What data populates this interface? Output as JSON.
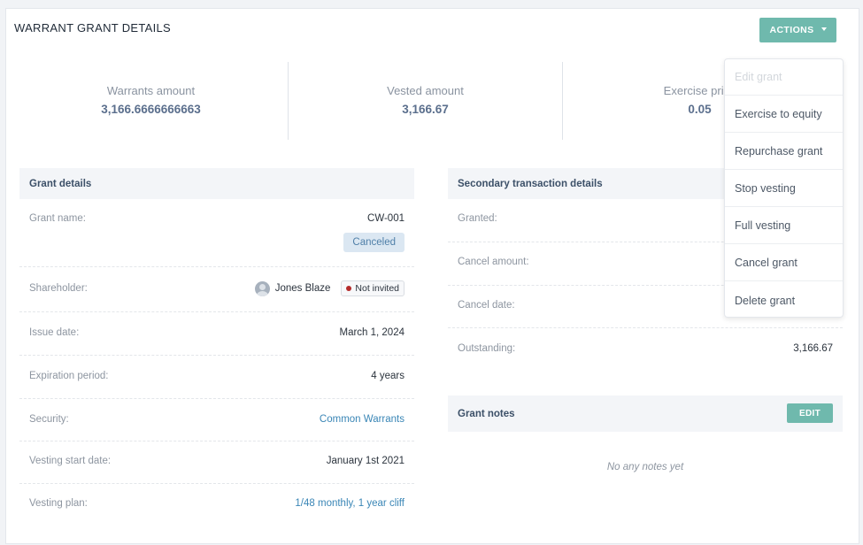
{
  "title": "WARRANT GRANT DETAILS",
  "actions_label": "ACTIONS",
  "stats": [
    {
      "label": "Warrants amount",
      "value": "3,166.6666666663"
    },
    {
      "label": "Vested amount",
      "value": "3,166.67"
    },
    {
      "label": "Exercise price",
      "value": "0.05"
    }
  ],
  "grant_details": {
    "heading": "Grant details",
    "grant_name_label": "Grant name:",
    "grant_name_value": "CW-001",
    "status_tag": "Canceled",
    "shareholder_label": "Shareholder:",
    "shareholder_name": "Jones Blaze",
    "shareholder_status": "Not invited",
    "issue_date_label": "Issue date:",
    "issue_date_value": "March 1, 2024",
    "expiration_label": "Expiration period:",
    "expiration_value": "4 years",
    "security_label": "Security:",
    "security_value": "Common Warrants",
    "vesting_start_label": "Vesting start date:",
    "vesting_start_value": "January 1st 2021",
    "vesting_plan_label": "Vesting plan:",
    "vesting_plan_value": "1/48 monthly, 1 year cliff"
  },
  "secondary": {
    "heading": "Secondary transaction details",
    "granted_label": "Granted:",
    "cancel_amount_label": "Cancel amount:",
    "cancel_date_label": "Cancel date:",
    "outstanding_label": "Outstanding:",
    "outstanding_value": "3,166.67"
  },
  "notes": {
    "heading": "Grant notes",
    "edit_label": "EDIT",
    "empty_text": "No any notes yet"
  },
  "menu": {
    "items": [
      "Edit grant",
      "Exercise to equity",
      "Repurchase grant",
      "Stop vesting",
      "Full vesting",
      "Cancel grant",
      "Delete grant"
    ]
  },
  "colors": {
    "accent": "#6fb9ad",
    "link": "#3a86b6",
    "status_red": "#b42a2a"
  }
}
